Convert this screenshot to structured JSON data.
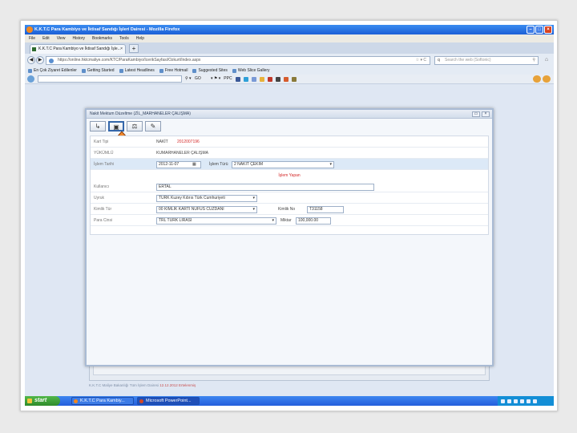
{
  "browser": {
    "title": "K.K.T.C Para Kambiyo ve İktisaf Sandığı İşleri Dairesi - Mozilla Firefox",
    "menu": [
      "File",
      "Edit",
      "View",
      "History",
      "Bookmarks",
      "Tools",
      "Help"
    ],
    "tab_title": "K.K.T.C Para Kambiyo ve İktisaf Sandığı İşle...",
    "url": "https://online.hktcmaliye.com/KTC/ParaKambiyo/IcerikSayfasi/Ozkurt/Index.aspx",
    "search_placeholder": "Search the web (Softonic)",
    "bookmarks": [
      "En Çok Ziyaret Edilenler",
      "Getting Started",
      "Latest Headlines",
      "Free Hotmail",
      "Suggested Sites",
      "Web Slice Gallery"
    ],
    "toolbar_go": "GO",
    "toolbar_ppc": "PPC"
  },
  "dialog": {
    "title": "Nakit Mektum Düzeltme (ZİL_MARHANELER ÇALIŞMA)",
    "tools": [
      "↳",
      "▣",
      "⚖",
      "✎"
    ],
    "fields": {
      "kart_tipi_label": "Kart Tipi",
      "kart_tipi_value": "NAKİT",
      "kart_no": "2012007196",
      "yuklenti_label": "YÜKÜMLÜ",
      "yuklenti_value": "KUMARHANELER ÇALIŞMA",
      "islem_tarihi_label": "İşlem Tarihi",
      "islem_tarihi_value": "2012-11-07",
      "islem_turu_label": "İşlem Türü",
      "islem_turu_value": "2 NAKİT ÇEKİM",
      "status": "İşlem Yapan",
      "kullanici_label": "Kullanıcı",
      "kullanici_value": "ERTAL",
      "ulke_label": "Uyruk",
      "ulke_value": "TÜRK Kuzey Kıbrıs Türk Cumhuriyeti",
      "kimlik_label": "Kimlik Tür",
      "kimlik_value": "00 KİMLİK KARTI NÜFUS CÜZDANI",
      "kimlik_no_label": "Kimlik No",
      "kimlik_no_value": "T31158",
      "para_label": "Para Cinsi",
      "para_value": "TRL TÜRK LİRASI",
      "miktar_label": "Miktar",
      "miktar_value": "100,000.00"
    }
  },
  "footer_text": "K.K.T.C Maliye Bakanlığı Tüm İşlem Dairesi",
  "footer_link": "12.12.2012 Ertelenmiş",
  "taskbar": {
    "start": "start",
    "tasks": [
      "K.K.T.C Para Kambiy...",
      "Microsoft PowerPoint..."
    ]
  },
  "colors": {
    "titlebar": "#1c5fd6",
    "taskbar": "#245edc",
    "start": "#2f8b2a",
    "highlight_row": "#dce9f7",
    "error_red": "#d42a2a"
  }
}
